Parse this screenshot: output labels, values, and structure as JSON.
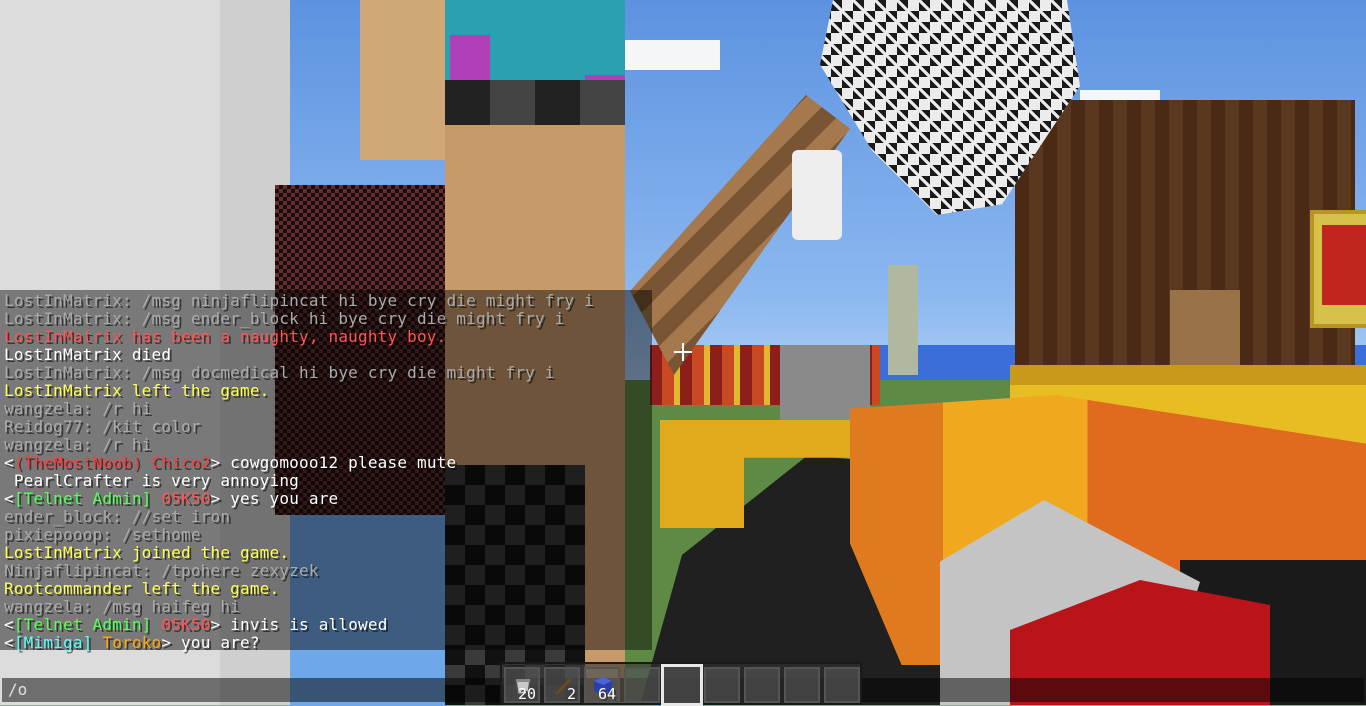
{
  "chat": {
    "lines": [
      {
        "color": "gray",
        "parts": [
          {
            "text": "LostInMatrix: /msg ninjaflipincat hi bye cry die might fry i",
            "color": "gray"
          }
        ]
      },
      {
        "color": "gray",
        "parts": [
          {
            "text": "LostInMatrix: /msg ender_block hi bye cry die might fry i",
            "color": "gray"
          }
        ]
      },
      {
        "color": "red",
        "parts": [
          {
            "text": "LostInMatrix has been a naughty, naughty boy.",
            "color": "red"
          }
        ]
      },
      {
        "color": "white",
        "parts": [
          {
            "text": "LostInMatrix died",
            "color": "white"
          }
        ]
      },
      {
        "color": "gray",
        "parts": [
          {
            "text": "LostInMatrix: /msg docmedical hi bye cry die might fry i",
            "color": "gray"
          }
        ]
      },
      {
        "color": "yellow",
        "parts": [
          {
            "text": "LostInMatrix left the game.",
            "color": "yellow"
          }
        ]
      },
      {
        "color": "gray",
        "parts": [
          {
            "text": "wangzela: /r hi",
            "color": "gray"
          }
        ]
      },
      {
        "color": "gray",
        "parts": [
          {
            "text": "Reidog77: /kit color",
            "color": "gray"
          }
        ]
      },
      {
        "color": "gray",
        "parts": [
          {
            "text": "wangzela: /r hi",
            "color": "gray"
          }
        ]
      },
      {
        "color": "white",
        "parts": [
          {
            "text": "<",
            "color": "white"
          },
          {
            "text": "(TheMostNoob)",
            "color": "darkred"
          },
          {
            "text": " ",
            "color": "white"
          },
          {
            "text": "Chico2",
            "color": "darkred"
          },
          {
            "text": "> cowgomooo12 please mute",
            "color": "white"
          }
        ]
      },
      {
        "color": "white",
        "parts": [
          {
            "text": " PearlCrafter is very annoying",
            "color": "white"
          }
        ]
      },
      {
        "color": "white",
        "parts": [
          {
            "text": "<",
            "color": "white"
          },
          {
            "text": "[Telnet Admin]",
            "color": "green"
          },
          {
            "text": " ",
            "color": "white"
          },
          {
            "text": "05K50",
            "color": "red"
          },
          {
            "text": "> yes you are",
            "color": "white"
          }
        ]
      },
      {
        "color": "gray",
        "parts": [
          {
            "text": "ender_block: //set iron",
            "color": "gray"
          }
        ]
      },
      {
        "color": "gray",
        "parts": [
          {
            "text": "pixiepooop: /sethome",
            "color": "gray"
          }
        ]
      },
      {
        "color": "yellow",
        "parts": [
          {
            "text": "LostInMatrix joined the game.",
            "color": "yellow"
          }
        ]
      },
      {
        "color": "gray",
        "parts": [
          {
            "text": "Ninjaflipincat: /tpohere zexyzek",
            "color": "gray"
          }
        ]
      },
      {
        "color": "yellow",
        "parts": [
          {
            "text": "Rootcommander left the game.",
            "color": "yellow"
          }
        ]
      },
      {
        "color": "gray",
        "parts": [
          {
            "text": "wangzela: /msg haifeg hi",
            "color": "gray"
          }
        ]
      },
      {
        "color": "white",
        "parts": [
          {
            "text": "<",
            "color": "white"
          },
          {
            "text": "[Telnet Admin]",
            "color": "green"
          },
          {
            "text": " ",
            "color": "white"
          },
          {
            "text": "05K50",
            "color": "red"
          },
          {
            "text": "> invis is allowed",
            "color": "white"
          }
        ]
      },
      {
        "color": "white",
        "parts": [
          {
            "text": "<",
            "color": "white"
          },
          {
            "text": "[Mimiga]",
            "color": "aqua"
          },
          {
            "text": " ",
            "color": "white"
          },
          {
            "text": "Toroko",
            "color": "gold"
          },
          {
            "text": "> you are?",
            "color": "white"
          }
        ]
      }
    ]
  },
  "chat_input": {
    "value": "/o"
  },
  "hotbar": {
    "selected_index": 4,
    "slots": [
      {
        "item": "bucket-icon",
        "count": "20"
      },
      {
        "item": "stick-icon",
        "count": "2"
      },
      {
        "item": "blue-wool-icon",
        "count": "64"
      },
      {
        "item": "",
        "count": ""
      },
      {
        "item": "",
        "count": ""
      },
      {
        "item": "",
        "count": ""
      },
      {
        "item": "",
        "count": ""
      },
      {
        "item": "",
        "count": ""
      },
      {
        "item": "",
        "count": ""
      }
    ]
  },
  "colors": {
    "gray": "#aaaaaa",
    "white": "#ffffff",
    "red": "#ff5555",
    "yellow": "#ffff55",
    "green": "#55ff55",
    "darkred": "#ff3b3b",
    "aqua": "#55ffff",
    "gold": "#ffaa00"
  }
}
